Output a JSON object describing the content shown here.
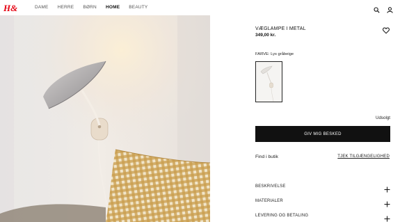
{
  "header": {
    "logo": "H&M",
    "nav": [
      "DAME",
      "HERRE",
      "BØRN",
      "HOME",
      "BEAUTY"
    ],
    "active_nav": "HOME",
    "icons": [
      "search-icon",
      "account-icon"
    ]
  },
  "product": {
    "title": "VÆGLAMPE I METAL",
    "price": "349,00 kr.",
    "color_label": "FARVE: Lys gråbeige",
    "status": "Udsolgt",
    "notify_button": "GIV MIG BESKED",
    "find_in_store": "Find i butik",
    "check_availability": "TJEK TILGÆNGELIGHED"
  },
  "accordions": [
    {
      "label": "BESKRIVELSE"
    },
    {
      "label": "MATERIALER"
    },
    {
      "label": "LEVERING OG BETALING"
    }
  ],
  "colors": {
    "brand_red": "#e50010",
    "button_black": "#111111"
  }
}
